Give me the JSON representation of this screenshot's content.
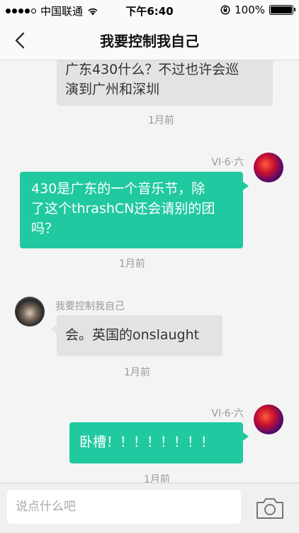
{
  "status_bar": {
    "carrier": "中国联通",
    "time": "下午6:40",
    "battery": "100%"
  },
  "nav": {
    "title": "我要控制我自己",
    "back_icon": "chevron-left-icon"
  },
  "messages": [
    {
      "side": "in",
      "text_lines": [
        "广东430什么？不过也许会巡",
        "演到广州和深圳"
      ],
      "time": "1月前"
    },
    {
      "side": "out",
      "sender": "VI·6·六",
      "text_lines": [
        "430是广东的一个音乐节，除",
        "了这个thrashCN还会请别的团",
        "吗？"
      ],
      "time": "1月前"
    },
    {
      "side": "in",
      "sender": "我要控制我自己",
      "text_lines": [
        "会。英国的onslaught"
      ],
      "time": "1月前"
    },
    {
      "side": "out",
      "sender": "VI·6·六",
      "text_lines": [
        "卧槽！！！！！！！！"
      ],
      "time": "1月前"
    }
  ],
  "input": {
    "placeholder": "说点什么吧",
    "value": ""
  },
  "colors": {
    "outgoing_bubble": "#21c9a0",
    "incoming_bubble": "#e3e3e3"
  }
}
